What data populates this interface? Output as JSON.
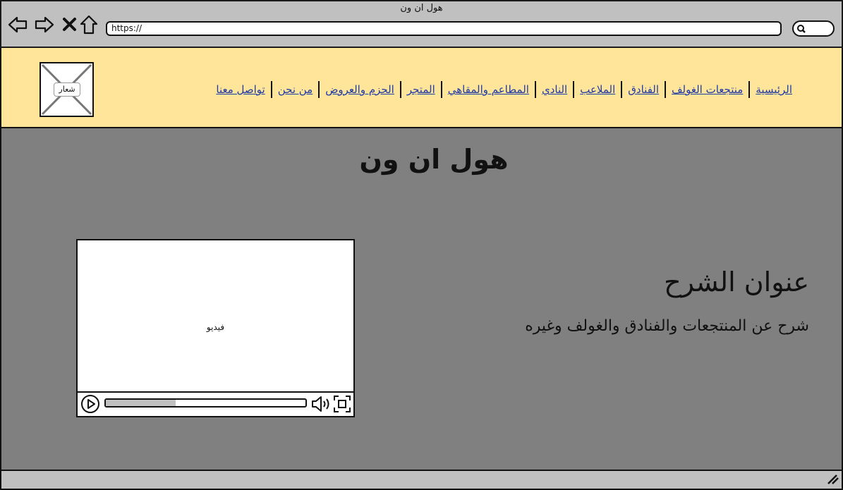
{
  "window": {
    "title": "هول ان ون"
  },
  "address_bar": {
    "url": "https://"
  },
  "logo": {
    "label": "شعار"
  },
  "nav": {
    "items": [
      "الرئيسية",
      "منتجعات الغولف",
      "الفنادق",
      "الملاعب",
      "النادي",
      "المطاعم والمقاهي",
      "المتجر",
      "الحزم والعروض",
      "من نحن",
      "تواصل معنا"
    ]
  },
  "main": {
    "title": "هول ان ون",
    "explain_title": "عنوان الشرح",
    "explain_text": "شرح عن المنتجعات والفنادق والغولف وغيره"
  },
  "video": {
    "label": "فيديو",
    "progress": 0.35
  },
  "colors": {
    "header_bg": "#ffe599",
    "main_bg": "#808080",
    "chrome_bg": "#c0c0c0",
    "link": "#1f3aa6"
  }
}
